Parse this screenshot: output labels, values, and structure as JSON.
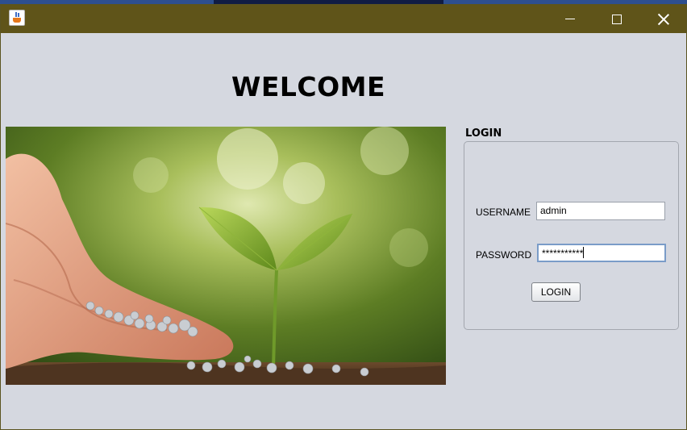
{
  "window": {
    "title": "",
    "controls": [
      "minimize",
      "maximize",
      "close"
    ]
  },
  "main": {
    "heading": "WELCOME",
    "image": "seedling-in-hand-photo"
  },
  "login_panel": {
    "title": "LOGIN",
    "username_label": "USERNAME",
    "username_value": "admin",
    "password_label": "PASSWORD",
    "password_value": "***********",
    "login_button": "LOGIN"
  },
  "colors": {
    "titlebar": "#5f5419",
    "background": "#d5d8e0",
    "focus_border": "#7a9cc8"
  }
}
